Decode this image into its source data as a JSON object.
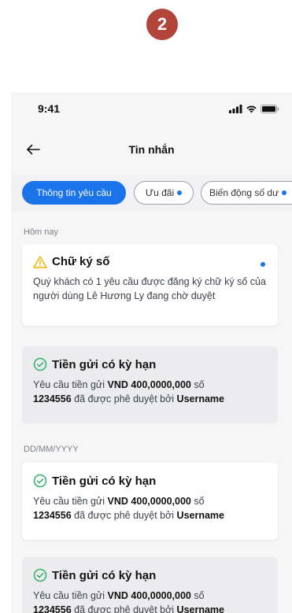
{
  "step_badge": "2",
  "status": {
    "time": "9:41"
  },
  "nav": {
    "title": "Tin nhắn"
  },
  "chips": [
    {
      "label": "Thông tin yêu cầu",
      "active": true
    },
    {
      "label": "Ưu đãi",
      "dot": true
    },
    {
      "label": "Biến động số dư",
      "dot": true
    }
  ],
  "sections": {
    "today": "Hôm nay",
    "date": "DD/MM/YYYY"
  },
  "cards": [
    {
      "title": "Chữ ký số",
      "icon": "warning-icon",
      "body": "Quý khách có 1 yêu cầu được đăng ký chữ ký số của người dùng Lê Hương Ly đang chờ duyệt",
      "unread": true
    },
    {
      "title": "Tiền gửi có kỳ hạn",
      "icon": "check-circle-icon",
      "body_prefix": "Yêu cầu tiền gửi ",
      "amount": "VND 400,0000,000",
      "body_mid": " số ",
      "account": "1234556",
      "body_suffix": " đã được phê duyệt bởi ",
      "user": "Username"
    },
    {
      "title": "Tiền gửi có kỳ hạn",
      "icon": "check-circle-icon",
      "body_prefix": "Yêu cầu tiền gửi ",
      "amount": "VND 400,0000,000",
      "body_mid": " số ",
      "account": "1234556",
      "body_suffix": " đã được phê duyệt bởi ",
      "user": "Username"
    },
    {
      "title": "Tiền gửi có kỳ hạn",
      "icon": "check-circle-icon",
      "body_prefix": "Yêu cầu tiền gửi ",
      "amount": "VND 400,0000,000",
      "body_mid": " số ",
      "account": "1234556",
      "body_suffix": " đã được phê duyệt bởi ",
      "user": "Username"
    }
  ],
  "colors": {
    "accent": "#1a73e8",
    "badge": "#b2453a",
    "success": "#2fb36b",
    "warning": "#f0b400"
  }
}
